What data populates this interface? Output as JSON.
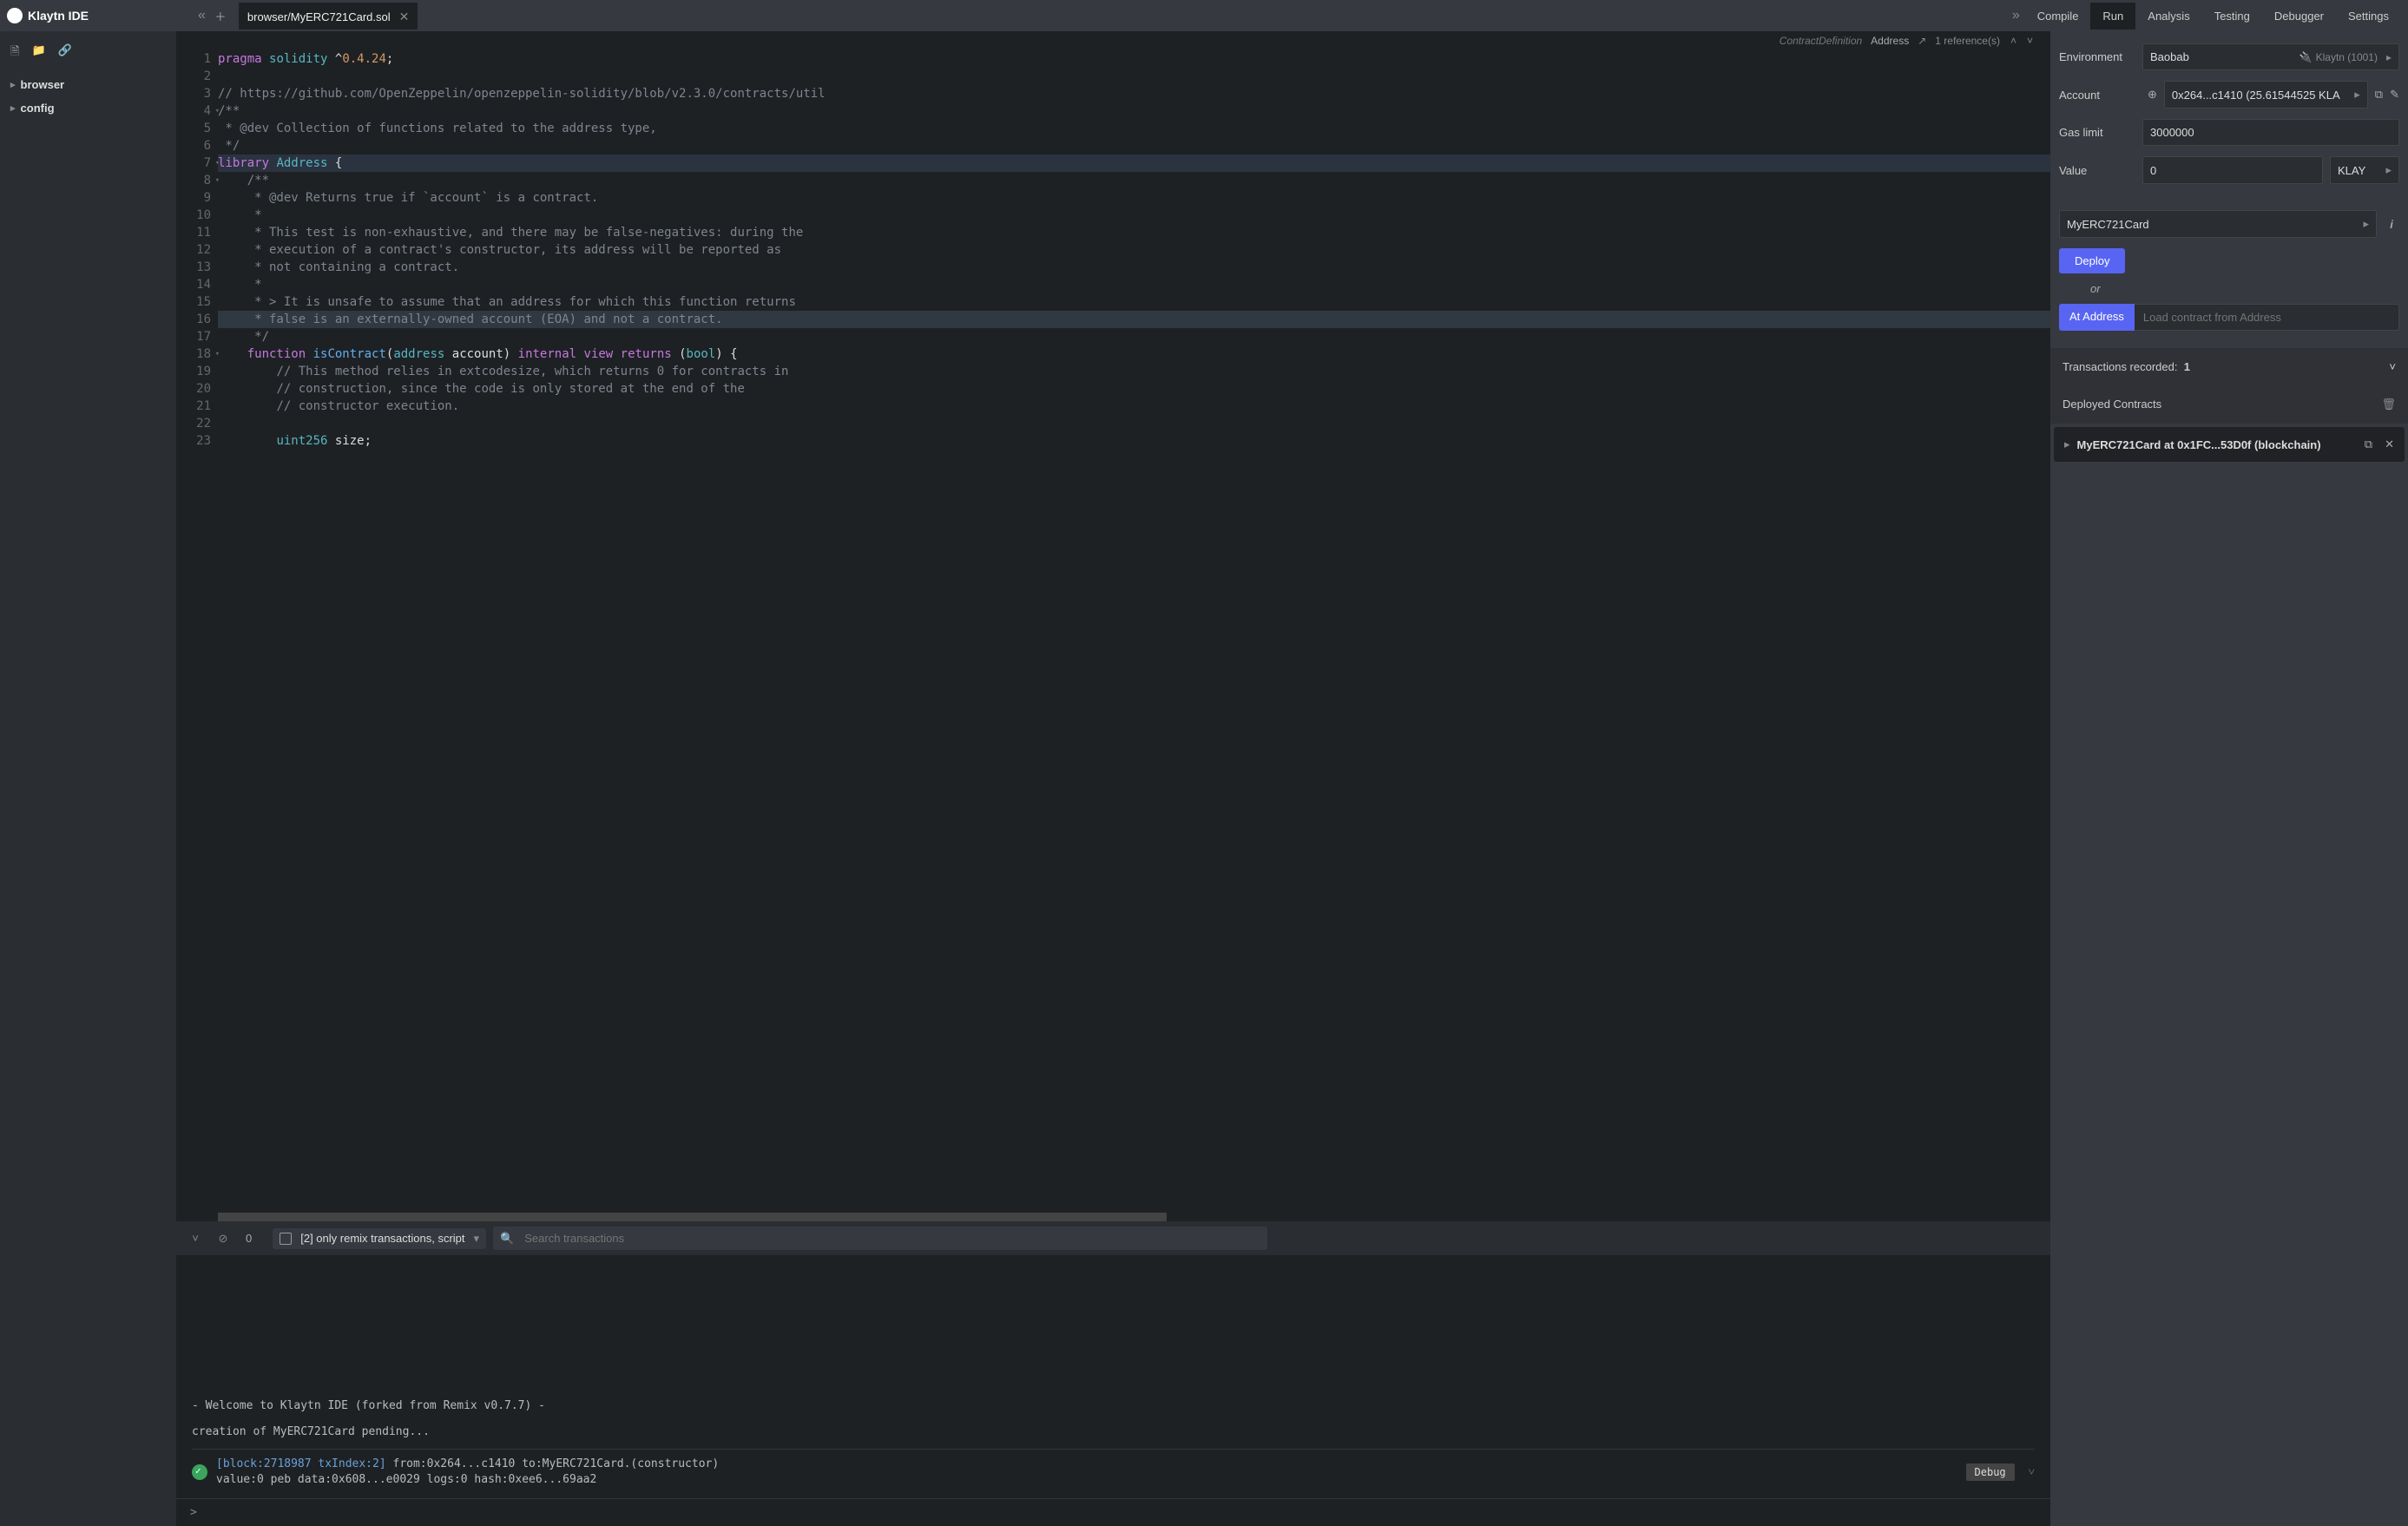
{
  "logo": "Klaytn IDE",
  "file_tab": "browser/MyERC721Card.sol",
  "right_tabs": [
    "Compile",
    "Run",
    "Analysis",
    "Testing",
    "Debugger",
    "Settings"
  ],
  "active_right_tab": "Run",
  "sidebar": {
    "items": [
      "browser",
      "config"
    ]
  },
  "context": {
    "def": "ContractDefinition",
    "addr": "Address",
    "refs": "1 reference(s)"
  },
  "code_lines": [
    {
      "n": 1,
      "html": "<span class='kw'>pragma</span> <span class='ty'>solidity</span> ^<span class='num'>0.4.24</span>;"
    },
    {
      "n": 2,
      "html": ""
    },
    {
      "n": 3,
      "html": "<span class='com'>// https://github.com/OpenZeppelin/openzeppelin-solidity/blob/v2.3.0/contracts/util</span>"
    },
    {
      "n": 4,
      "fold": true,
      "html": "<span class='com'>/**</span>"
    },
    {
      "n": 5,
      "html": "<span class='com'> * @dev Collection of functions related to the address type,</span>"
    },
    {
      "n": 6,
      "html": "<span class='com'> */</span>"
    },
    {
      "n": 7,
      "fold": true,
      "cls": "hl7",
      "html": "<span class='kw'>library</span> <span class='ty'>Address</span> {"
    },
    {
      "n": 8,
      "fold": true,
      "html": "    <span class='com'>/**</span>"
    },
    {
      "n": 9,
      "html": "    <span class='com'> * @dev Returns true if `account` is a contract.</span>"
    },
    {
      "n": 10,
      "html": "    <span class='com'> *</span>"
    },
    {
      "n": 11,
      "html": "    <span class='com'> * This test is non-exhaustive, and there may be false-negatives: during the</span>"
    },
    {
      "n": 12,
      "html": "    <span class='com'> * execution of a contract's constructor, its address will be reported as</span>"
    },
    {
      "n": 13,
      "html": "    <span class='com'> * not containing a contract.</span>"
    },
    {
      "n": 14,
      "html": "    <span class='com'> *</span>"
    },
    {
      "n": 15,
      "html": "    <span class='com'> * > It is unsafe to assume that an address for which this function returns</span>"
    },
    {
      "n": 16,
      "cls": "hl16",
      "html": "    <span class='com'> * false is an externally-owned account (EOA) and not a contract.</span>"
    },
    {
      "n": 17,
      "html": "    <span class='com'> */</span>"
    },
    {
      "n": 18,
      "fold": true,
      "html": "    <span class='kw'>function</span> <span class='fn'>isContract</span>(<span class='ty'>address</span> account) <span class='kw'>internal</span> <span class='kw'>view</span> <span class='ret'>returns</span> (<span class='ty'>bool</span>) {"
    },
    {
      "n": 19,
      "html": "        <span class='com'>// This method relies in extcodesize, which returns 0 for contracts in</span>"
    },
    {
      "n": 20,
      "html": "        <span class='com'>// construction, since the code is only stored at the end of the</span>"
    },
    {
      "n": 21,
      "html": "        <span class='com'>// constructor execution.</span>"
    },
    {
      "n": 22,
      "html": ""
    },
    {
      "n": 23,
      "html": "        <span class='ty'>uint256</span> size;"
    }
  ],
  "console_bar": {
    "zero": "0",
    "filter_label": "[2] only remix transactions, script",
    "search_placeholder": "Search transactions"
  },
  "console": {
    "welcome": " - Welcome to Klaytn IDE (forked from Remix v0.7.7) - ",
    "pending": "creation of MyERC721Card pending...",
    "tx": {
      "block": "[block:2718987 txIndex:2]",
      "line1": "from:0x264...c1410 to:MyERC721Card.(constructor)",
      "line2": "value:0 peb data:0x608...e0029 logs:0 hash:0xee6...69aa2"
    },
    "debug": "Debug",
    "prompt": ">"
  },
  "run": {
    "env_label": "Environment",
    "env_value": "Baobab",
    "env_net": "Klaytn (1001)",
    "acct_label": "Account",
    "acct_value": "0x264...c1410 (25.61544525 KLA",
    "gas_label": "Gas limit",
    "gas_value": "3000000",
    "val_label": "Value",
    "val_value": "0",
    "val_unit": "KLAY",
    "contract": "MyERC721Card",
    "deploy": "Deploy",
    "or": "or",
    "at_addr": "At Address",
    "at_placeholder": "Load contract from Address",
    "tx_recorded": "Transactions recorded:",
    "tx_count": "1",
    "deployed_header": "Deployed Contracts",
    "deployed_item": "MyERC721Card at 0x1FC...53D0f (blockchain)"
  }
}
